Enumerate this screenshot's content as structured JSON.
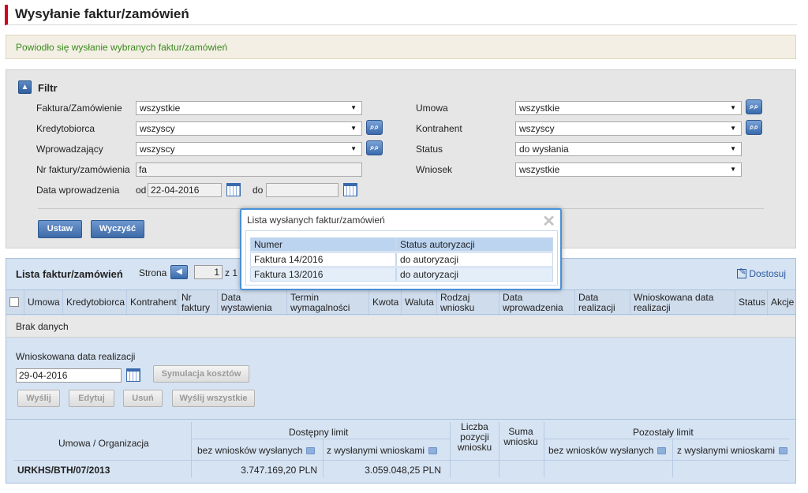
{
  "page": {
    "title": "Wysyłanie faktur/zamówień"
  },
  "message": {
    "text": "Powiodło się wysłanie wybranych faktur/zamówień"
  },
  "filter": {
    "title": "Filtr",
    "collapse_icon": "▲",
    "fields": {
      "faktura": {
        "label": "Faktura/Zamówienie",
        "value": "wszystkie"
      },
      "kredytobiorca": {
        "label": "Kredytobiorca",
        "value": "wszyscy"
      },
      "wprowadzajacy": {
        "label": "Wprowadzający",
        "value": "wszyscy"
      },
      "nr": {
        "label": "Nr faktury/zamówienia",
        "value": "fa"
      },
      "data": {
        "label": "Data wprowadzenia",
        "od_label": "od",
        "od_value": "22-04-2016",
        "do_label": "do",
        "do_value": ""
      },
      "umowa": {
        "label": "Umowa",
        "value": "wszystkie"
      },
      "kontrahent": {
        "label": "Kontrahent",
        "value": "wszyscy"
      },
      "status": {
        "label": "Status",
        "value": "do wysłania"
      },
      "wniosek": {
        "label": "Wniosek",
        "value": "wszystkie"
      }
    },
    "buttons": {
      "ustaw": "Ustaw",
      "wyczysc": "Wyczyść"
    }
  },
  "list": {
    "title": "Lista faktur/zamówień",
    "strona_label": "Strona",
    "page_value": "1",
    "page_of": "z 1",
    "dostosuj": "Dostosuj",
    "columns": {
      "umowa": "Umowa",
      "kredytobiorca": "Kredytobiorca",
      "kontrahent": "Kontrahent",
      "nr1": "Nr",
      "nr2": "faktury",
      "dw1": "Data",
      "dw2": "wystawienia",
      "tw1": "Termin",
      "tw2": "wymagalności",
      "kwota": "Kwota",
      "waluta": "Waluta",
      "rw1": "Rodzaj",
      "rw2": "wniosku",
      "dwp1": "Data",
      "dwp2": "wprowadzenia",
      "dr1": "Data",
      "dr2": "realizacji",
      "wdr1": "Wnioskowana data",
      "wdr2": "realizacji",
      "status": "Status",
      "akcje": "Akcje"
    },
    "empty": "Brak danych",
    "wnioskowana_label": "Wnioskowana data realizacji",
    "wnioskowana_value": "29-04-2016",
    "buttons": {
      "symulacja": "Symulacja kosztów",
      "wyslij": "Wyślij",
      "edytuj": "Edytuj",
      "usun": "Usuń",
      "wyslij_wszystkie": "Wyślij wszystkie"
    },
    "limits": {
      "umowa_org": "Umowa / Organizacja",
      "dostepny": "Dostępny limit",
      "bez": "bez wniosków wysłanych",
      "z": "z wysłanymi wnioskami",
      "liczba1": "Liczba",
      "liczba2": "pozycji",
      "liczba3": "wniosku",
      "suma1": "Suma",
      "suma2": "wniosku",
      "pozostaly": "Pozostały limit",
      "bez2": "bez wniosków wysłanych",
      "z2": "z wysłanymi wnioskami",
      "row": {
        "umowa": "URKHS/BTH/07/2013",
        "bez": "3.747.169,20 PLN",
        "z": "3.059.048,25 PLN"
      }
    }
  },
  "popup": {
    "title": "Lista wysłanych faktur/zamówień",
    "close_icon": "✕",
    "headers": {
      "numer": "Numer",
      "status": "Status autoryzacji"
    },
    "rows": [
      {
        "numer": "Faktura 14/2016",
        "status": "do autoryzacji"
      },
      {
        "numer": "Faktura 13/2016",
        "status": "do autoryzacji"
      }
    ]
  },
  "icons": {
    "binoculars": "binoculars-icon",
    "calendar": "calendar-icon",
    "filter": "filter-icon",
    "edit": "edit-icon"
  },
  "colors": {
    "accent": "#d0021b",
    "success": "#3a8a1e",
    "blue": "#3e6aa8"
  }
}
